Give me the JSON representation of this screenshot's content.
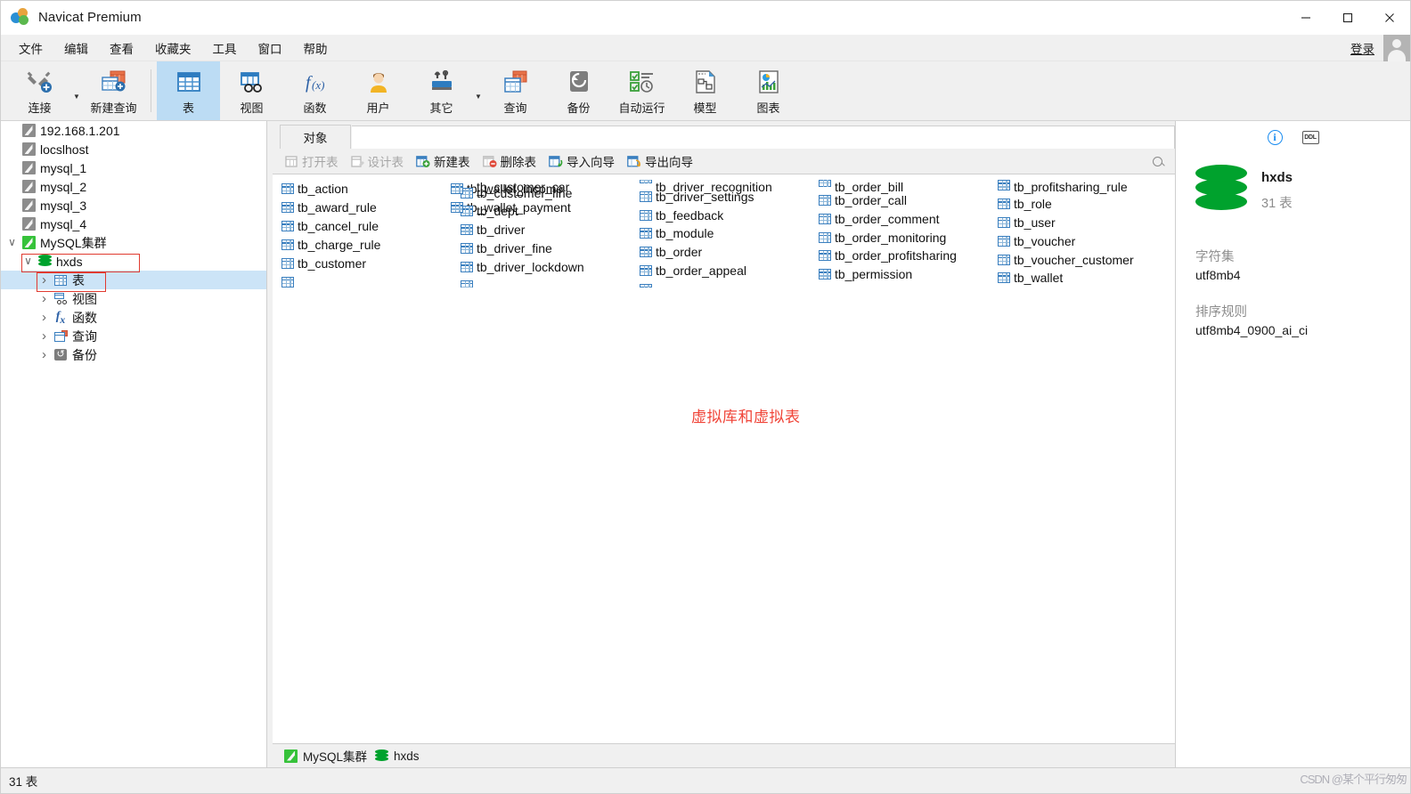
{
  "window": {
    "title": "Navicat Premium",
    "logo_icon": "navicat-logo-icon",
    "minimize": "—",
    "maximize": "□",
    "close": "✕"
  },
  "menubar": {
    "items": [
      {
        "label": "文件"
      },
      {
        "label": "编辑"
      },
      {
        "label": "查看"
      },
      {
        "label": "收藏夹"
      },
      {
        "label": "工具"
      },
      {
        "label": "窗口"
      },
      {
        "label": "帮助"
      }
    ],
    "login_label": "登录"
  },
  "ribbon": {
    "buttons": [
      {
        "label": "连接",
        "icon": "connection-icon",
        "active": false,
        "caret": true
      },
      {
        "label": "新建查询",
        "icon": "new-query-icon",
        "active": false,
        "caret": false
      },
      {
        "label": "表",
        "icon": "table-icon",
        "active": true,
        "caret": false
      },
      {
        "label": "视图",
        "icon": "view-icon",
        "active": false,
        "caret": false
      },
      {
        "label": "函数",
        "icon": "function-icon",
        "active": false,
        "caret": false
      },
      {
        "label": "用户",
        "icon": "user-icon",
        "active": false,
        "caret": false
      },
      {
        "label": "其它",
        "icon": "other-tools-icon",
        "active": false,
        "caret": true
      },
      {
        "label": "查询",
        "icon": "query-icon",
        "active": false,
        "caret": false
      },
      {
        "label": "备份",
        "icon": "backup-icon",
        "active": false,
        "caret": false
      },
      {
        "label": "自动运行",
        "icon": "automation-icon",
        "active": false,
        "caret": false
      },
      {
        "label": "模型",
        "icon": "model-icon",
        "active": false,
        "caret": false
      },
      {
        "label": "图表",
        "icon": "chart-icon",
        "active": false,
        "caret": false
      }
    ]
  },
  "sidebar": {
    "nodes": [
      {
        "label": "192.168.1.201",
        "icon": "connection-icon",
        "indent": 0,
        "twisty": "none",
        "connected": false,
        "selected": false,
        "highlight": false
      },
      {
        "label": "locslhost",
        "icon": "connection-icon",
        "indent": 0,
        "twisty": "none",
        "connected": false,
        "selected": false,
        "highlight": false
      },
      {
        "label": "mysql_1",
        "icon": "connection-icon",
        "indent": 0,
        "twisty": "none",
        "connected": false,
        "selected": false,
        "highlight": false
      },
      {
        "label": "mysql_2",
        "icon": "connection-icon",
        "indent": 0,
        "twisty": "none",
        "connected": false,
        "selected": false,
        "highlight": false
      },
      {
        "label": "mysql_3",
        "icon": "connection-icon",
        "indent": 0,
        "twisty": "none",
        "connected": false,
        "selected": false,
        "highlight": false
      },
      {
        "label": "mysql_4",
        "icon": "connection-icon",
        "indent": 0,
        "twisty": "none",
        "connected": false,
        "selected": false,
        "highlight": false
      },
      {
        "label": "MySQL集群",
        "icon": "connection-icon",
        "indent": 0,
        "twisty": "open",
        "connected": true,
        "selected": false,
        "highlight": true
      },
      {
        "label": "hxds",
        "icon": "database-icon",
        "indent": 1,
        "twisty": "open",
        "connected": true,
        "selected": false,
        "highlight": true
      },
      {
        "label": "表",
        "icon": "table-icon",
        "indent": 2,
        "twisty": "closed",
        "connected": false,
        "selected": true,
        "highlight": false
      },
      {
        "label": "视图",
        "icon": "view-icon",
        "indent": 2,
        "twisty": "closed",
        "connected": false,
        "selected": false,
        "highlight": false
      },
      {
        "label": "函数",
        "icon": "function-icon",
        "indent": 2,
        "twisty": "closed",
        "connected": false,
        "selected": false,
        "highlight": false
      },
      {
        "label": "查询",
        "icon": "query-icon",
        "indent": 2,
        "twisty": "closed",
        "connected": false,
        "selected": false,
        "highlight": false
      },
      {
        "label": "备份",
        "icon": "backup-icon",
        "indent": 2,
        "twisty": "closed",
        "connected": false,
        "selected": false,
        "highlight": false
      }
    ]
  },
  "main": {
    "tab_label": "对象",
    "toolbar": [
      {
        "label": "打开表",
        "icon": "open-table-icon",
        "disabled": true
      },
      {
        "label": "设计表",
        "icon": "design-table-icon",
        "disabled": true
      },
      {
        "label": "新建表",
        "icon": "new-table-icon",
        "disabled": false
      },
      {
        "label": "删除表",
        "icon": "delete-table-icon",
        "disabled": false
      },
      {
        "label": "导入向导",
        "icon": "import-wizard-icon",
        "disabled": false
      },
      {
        "label": "导出向导",
        "icon": "export-wizard-icon",
        "disabled": false
      }
    ],
    "search_icon": "search-icon",
    "tables": [
      "tb_action",
      "tb_award_rule",
      "tb_cancel_rule",
      "tb_charge_rule",
      "tb_customer",
      "tb_customer_car",
      "tb_customer_fine",
      "tb_dept",
      "tb_driver",
      "tb_driver_fine",
      "tb_driver_lockdown",
      "tb_driver_recognition",
      "tb_driver_settings",
      "tb_feedback",
      "tb_module",
      "tb_order",
      "tb_order_appeal",
      "tb_order_bill",
      "tb_order_call",
      "tb_order_comment",
      "tb_order_monitoring",
      "tb_order_profitsharing",
      "tb_permission",
      "tb_profitsharing_rule",
      "tb_role",
      "tb_user",
      "tb_voucher",
      "tb_voucher_customer",
      "tb_wallet",
      "tb_wallet_income",
      "tb_wallet_payment"
    ],
    "annotation": "虚拟库和虚拟表"
  },
  "infopanel": {
    "tab_info_icon": "info-icon",
    "tab_ddl_icon": "ddl-icon",
    "db_icon": "database-icon",
    "db_name": "hxds",
    "db_count": "31 表",
    "charset_label": "字符集",
    "charset_value": "utf8mb4",
    "collation_label": "排序规则",
    "collation_value": "utf8mb4_0900_ai_ci"
  },
  "statusbar": {
    "left": "31 表",
    "connection": "MySQL集群",
    "database": "hxds",
    "watermark": "CSDN @某个平行匆匆"
  },
  "colors": {
    "accent": "#1a8cf0",
    "selection": "#cce4f7",
    "annotation_red": "#f04438",
    "db_green": "#00a22d",
    "chrome": "#f0f0f0"
  }
}
